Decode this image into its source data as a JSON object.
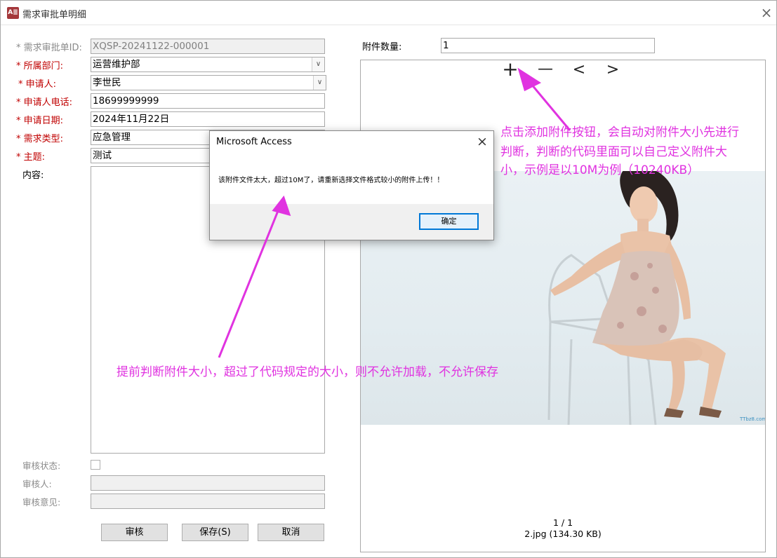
{
  "window": {
    "title": "需求审批单明细",
    "app_icon": "A≣"
  },
  "form": {
    "id_label": "* 需求审批单ID:",
    "id_value": "XQSP-20241122-000001",
    "dept_label": "* 所属部门:",
    "dept_value": "运营维护部",
    "applicant_label": "* 申请人:",
    "applicant_value": "李世民",
    "phone_label": "* 申请人电话:",
    "phone_value": "18699999999",
    "date_label": "* 申请日期:",
    "date_value": "2024年11月22日",
    "type_label": "* 需求类型:",
    "type_value": "应急管理",
    "subject_label": "* 主题:",
    "subject_value": "测试",
    "content_label": "内容:",
    "review_status_label": "审核状态:",
    "reviewer_label": "审核人:",
    "review_opinion_label": "审核意见:"
  },
  "buttons": {
    "review": "审核",
    "save": "保存(S)",
    "cancel": "取消"
  },
  "attachment": {
    "count_label": "附件数量:",
    "count_value": "1",
    "nav": {
      "add": "+",
      "remove": "—",
      "prev": "<",
      "next": ">"
    },
    "page_indicator": "1 / 1",
    "file_info": "2.jpg (134.30 KB)",
    "watermark": "TTbz8.com"
  },
  "dialog": {
    "title": "Microsoft Access",
    "message": "该附件文件太大，超过10M了，请重新选择文件格式较小的附件上传！！",
    "ok_label": "确定"
  },
  "annotations": {
    "top_right": [
      "点击添加附件按钮，会自动对附件大小先进行",
      "判断，判断的代码里面可以自己定义附件大",
      "小，示例是以10M为例（10240KB）"
    ],
    "bottom": "提前判断附件大小，超过了代码规定的大小，则不允许加载，不允许保存",
    "color": "#e033e0"
  },
  "colors": {
    "required_label": "#c00000",
    "annotation": "#e033e0"
  }
}
